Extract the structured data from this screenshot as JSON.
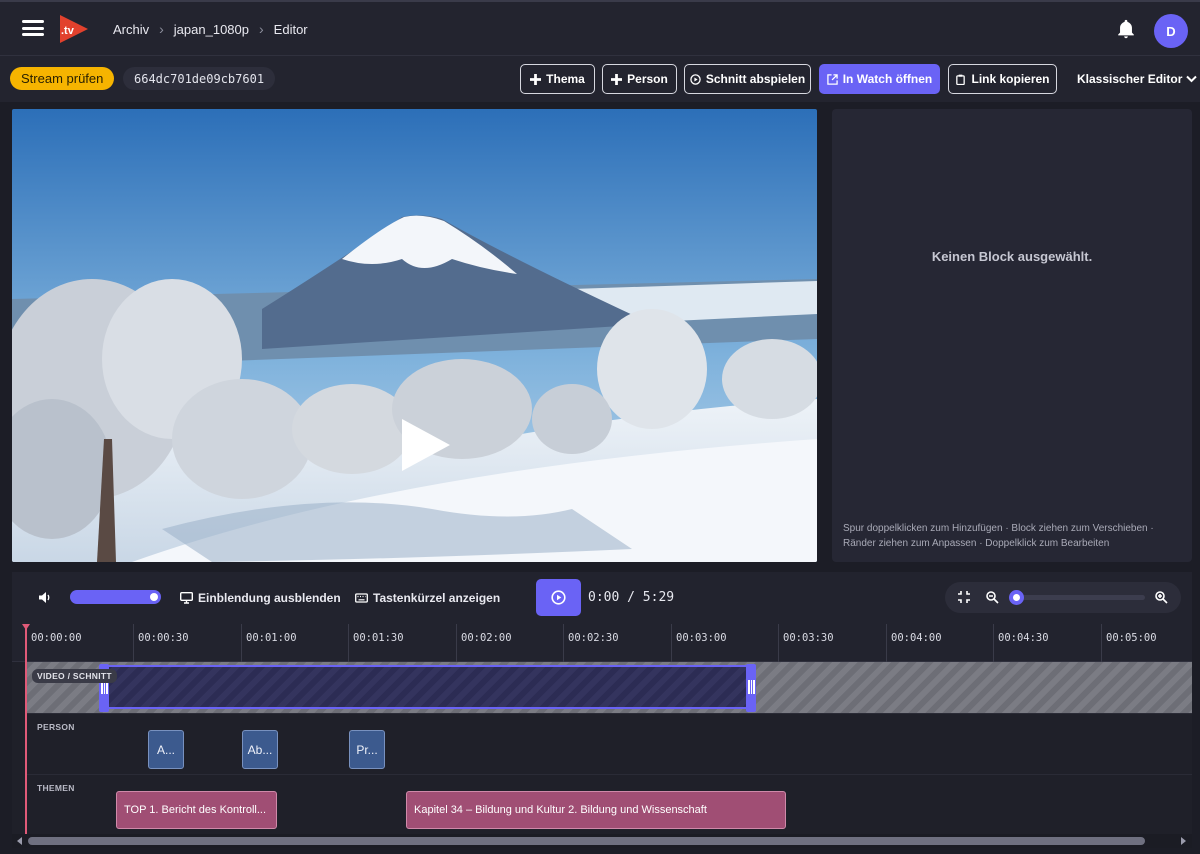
{
  "app": {
    "logo_text": ".tv",
    "colors": {
      "accent": "#6a63f5",
      "warning": "#f6b400",
      "person_block": "#3c5a8e",
      "theme_block": "#a04e74",
      "playhead": "#e05a78"
    }
  },
  "breadcrumb": [
    "Archiv",
    "japan_1080p",
    "Editor"
  ],
  "user": {
    "avatar_initial": "D"
  },
  "toolbar": {
    "stream_check_label": "Stream prüfen",
    "stream_id": "664dc701de09cb7601",
    "buttons": {
      "theme": "Thema",
      "person": "Person",
      "play_cut": "Schnitt abspielen",
      "open_watch": "In Watch öffnen",
      "copy_link": "Link kopieren"
    },
    "classic_editor": "Klassischer Editor"
  },
  "inspector": {
    "empty_message": "Keinen Block ausgewählt.",
    "hint": "Spur doppelklicken zum Hinzufügen · Block ziehen zum Verschieben · Ränder ziehen zum Anpassen · Doppelklick zum Bearbeiten"
  },
  "controls": {
    "volume_level": 1.0,
    "hide_overlay_label": "Einblendung ausblenden",
    "shortcuts_label": "Tastenkürzel anzeigen",
    "current_time": "0:00",
    "duration": "5:29",
    "zoom_level": 0.0
  },
  "timeline": {
    "ticks": [
      "00:00:00",
      "00:00:30",
      "00:01:00",
      "00:01:30",
      "00:02:00",
      "00:02:30",
      "00:03:00",
      "00:03:30",
      "00:04:00",
      "00:04:30",
      "00:05:00"
    ],
    "tracks": {
      "video": {
        "label": "VIDEO / SCHNITT"
      },
      "person": {
        "label": "PERSON",
        "blocks": [
          "A...",
          "Ab...",
          "Pr..."
        ]
      },
      "themes": {
        "label": "THEMEN",
        "blocks": [
          "TOP 1. Bericht des Kontroll...",
          "Kapitel 34 – Bildung und Kultur 2. Bildung und Wissenschaft"
        ]
      }
    }
  }
}
